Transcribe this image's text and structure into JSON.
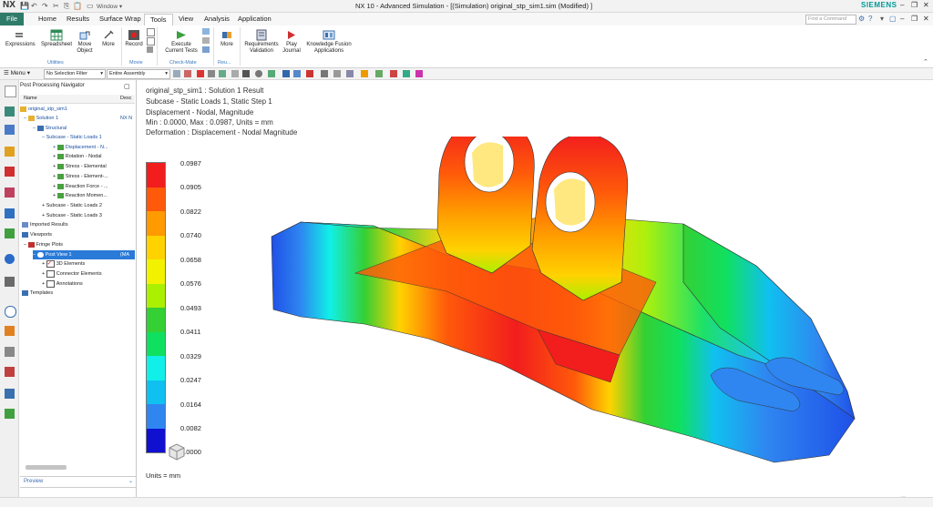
{
  "window": {
    "app_badge": "NX",
    "title": "NX 10 - Advanced Simulation - [(Simulation) original_stp_sim1.sim (Modified) ]",
    "window_menu": "Window",
    "brand": "SIEMENS"
  },
  "tabs": [
    "File",
    "Home",
    "Results",
    "Surface Wrap",
    "Tools",
    "View",
    "Analysis",
    "Application"
  ],
  "active_tab": "Tools",
  "find_command_placeholder": "Find a Command",
  "ribbon": {
    "utilities": {
      "group_label": "Utilities",
      "buttons": [
        "Expressions",
        "Spreadsheet",
        "Move Object",
        "More"
      ]
    },
    "movie": {
      "group_label": "Movie",
      "buttons": [
        "Record"
      ]
    },
    "check_mate": {
      "group_label": "Check-Mate",
      "buttons": [
        "Execute Current Tests"
      ]
    },
    "reuse": {
      "group_label": "Reu...",
      "buttons": [
        "More"
      ]
    },
    "other": {
      "buttons": [
        "Requirements Validation",
        "Play Journal",
        "Knowledge Fusion Applications"
      ]
    }
  },
  "toolbar": {
    "menu_label": "Menu",
    "selection_filter": "No Selection Filter",
    "assembly_scope": "Entire Assembly"
  },
  "navigator": {
    "title": "Post Processing Navigator",
    "columns": [
      "Name",
      "Desc"
    ],
    "tree": [
      {
        "label": "original_stp_sim1",
        "desc": ""
      },
      {
        "label": "Solution 1",
        "desc": "NX N"
      },
      {
        "label": "Structural",
        "desc": ""
      },
      {
        "label": "Subcase - Static Loads 1",
        "desc": ""
      },
      {
        "label": "Displacement - N...",
        "desc": ""
      },
      {
        "label": "Rotation - Nodal",
        "desc": ""
      },
      {
        "label": "Stress - Elemental",
        "desc": ""
      },
      {
        "label": "Stress - Element-...",
        "desc": ""
      },
      {
        "label": "Reaction Force - ...",
        "desc": ""
      },
      {
        "label": "Reaction Momen...",
        "desc": ""
      },
      {
        "label": "Subcase - Static Loads 2",
        "desc": ""
      },
      {
        "label": "Subcase - Static Loads 3",
        "desc": ""
      },
      {
        "label": "Imported Results",
        "desc": ""
      },
      {
        "label": "Viewports",
        "desc": ""
      },
      {
        "label": "Fringe Plots",
        "desc": ""
      },
      {
        "label": "Post View 1",
        "desc": "(MA"
      },
      {
        "label": "3D Elements",
        "desc": ""
      },
      {
        "label": "Connector Elements",
        "desc": ""
      },
      {
        "label": "Annotations",
        "desc": ""
      },
      {
        "label": "Templates",
        "desc": ""
      }
    ],
    "preview_label": "Preview"
  },
  "result_info": [
    "original_stp_sim1 : Solution 1 Result",
    "Subcase - Static Loads 1, Static Step 1",
    "Displacement - Nodal, Magnitude",
    "Min : 0.0000, Max : 0.0987, Units = mm",
    "Deformation : Displacement - Nodal Magnitude"
  ],
  "legend": {
    "values": [
      "0.0987",
      "0.0905",
      "0.0822",
      "0.0740",
      "0.0658",
      "0.0576",
      "0.0493",
      "0.0411",
      "0.0329",
      "0.0247",
      "0.0164",
      "0.0082",
      "0.0000"
    ],
    "colors": [
      "#f21d1d",
      "#ff5a0a",
      "#ff9a00",
      "#ffd200",
      "#f2f200",
      "#aaf000",
      "#34d034",
      "#10e060",
      "#10f0e8",
      "#10c0f0",
      "#2f86f0",
      "#1f50e8",
      "#1010d0"
    ],
    "units_label": "Units = mm"
  }
}
